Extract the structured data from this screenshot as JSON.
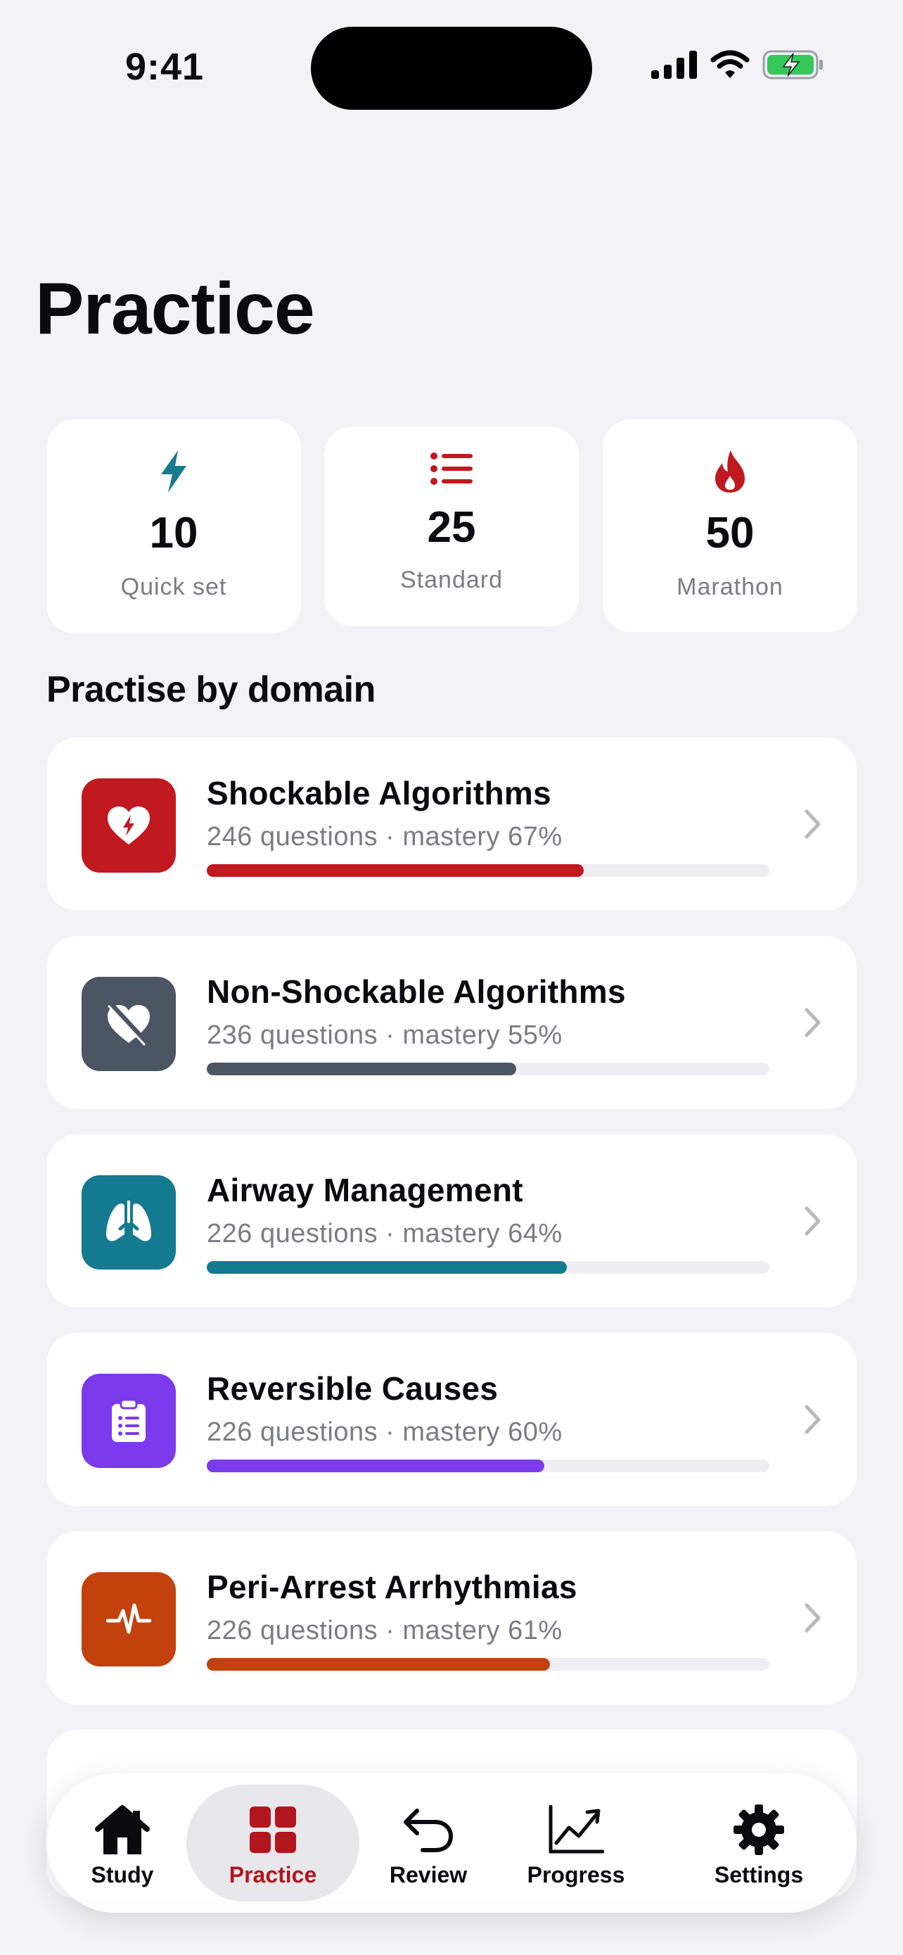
{
  "status": {
    "time": "9:41"
  },
  "title": "Practice",
  "quick_sets": [
    {
      "number": "10",
      "label": "Quick set",
      "icon": "bolt-icon",
      "color": "#177A8E"
    },
    {
      "number": "25",
      "label": "Standard",
      "icon": "list-icon",
      "color": "#C0191F"
    },
    {
      "number": "50",
      "label": "Marathon",
      "icon": "flame-icon",
      "color": "#C0191F"
    }
  ],
  "section_title": "Practise by domain",
  "domains": [
    {
      "name": "Shockable Algorithms",
      "meta": "246 questions · mastery 67%",
      "mastery": 0.67,
      "color": "#C0191F",
      "icon": "heart-bolt-icon"
    },
    {
      "name": "Non-Shockable Algorithms",
      "meta": "236 questions · mastery 55%",
      "mastery": 0.55,
      "color": "#4B5563",
      "icon": "heart-slash-icon"
    },
    {
      "name": "Airway Management",
      "meta": "226 questions · mastery 64%",
      "mastery": 0.64,
      "color": "#147A8F",
      "icon": "lungs-icon"
    },
    {
      "name": "Reversible Causes",
      "meta": "226 questions · mastery 60%",
      "mastery": 0.6,
      "color": "#7C3AED",
      "icon": "clipboard-icon"
    },
    {
      "name": "Peri-Arrest Arrhythmias",
      "meta": "226 questions · mastery 61%",
      "mastery": 0.61,
      "color": "#C2410C",
      "icon": "pulse-icon"
    }
  ],
  "tabs": [
    {
      "label": "Study",
      "icon": "house-icon"
    },
    {
      "label": "Practice",
      "icon": "grid-icon",
      "active": true,
      "color": "#B0161C"
    },
    {
      "label": "Review",
      "icon": "undo-arrow-icon"
    },
    {
      "label": "Progress",
      "icon": "chart-line-icon"
    },
    {
      "label": "Settings",
      "icon": "gear-icon"
    }
  ]
}
